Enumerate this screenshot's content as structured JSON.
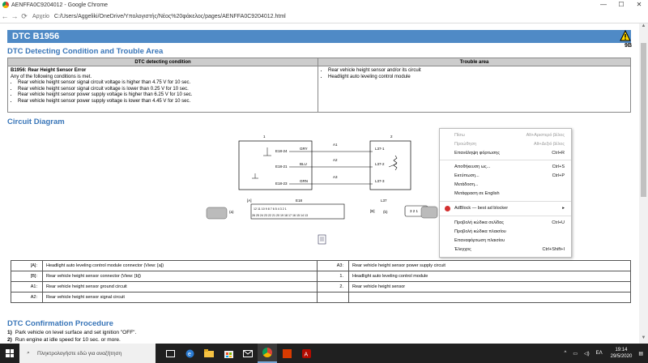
{
  "window": {
    "title": "AENFFA0C9204012 - Google Chrome",
    "min": "—",
    "max": "☐",
    "close": "✕"
  },
  "address": {
    "info": "Αρχείο",
    "url": "C:/Users/Aggeliki/OneDrive/Υπολογιστής/Νέος%20φάκελος/pages/AENFFA0C9204012.html",
    "back": "←",
    "forward": "→",
    "reload": "⟳"
  },
  "page": {
    "dtc_title": "DTC B1956",
    "ref": "9B",
    "section_condition": "DTC Detecting Condition and Trouble Area",
    "th_condition": "DTC detecting condition",
    "th_trouble": "Trouble area",
    "cond_title": "B1956: Rear Height Sensor Error",
    "cond_intro": "Any of the following conditions is met.",
    "cond_items": [
      "Rear vehicle height sensor signal circuit voltage is higher than 4.75 V for 10 sec.",
      "Rear vehicle height sensor signal circuit voltage is lower than 0.25 V for 10 sec.",
      "Rear vehicle height sensor power supply voltage is higher than 6.25 V for 10 sec.",
      "Rear vehicle height sensor power supply voltage is lower than 4.45 V for 10 sec."
    ],
    "trouble_items": [
      "Rear vehicle height sensor and/or its circuit",
      "Headlight auto leveling control module"
    ],
    "section_circuit": "Circuit Diagram",
    "diagram": {
      "box1": "1",
      "box2": "2",
      "e18_24": "E18-24",
      "e18_21": "E18-21",
      "e18_23": "E18-23",
      "gry": "GRY",
      "blu": "BLU",
      "grn": "GRN",
      "a1": "A1",
      "a2": "A2",
      "a3": "A3",
      "l37_1": "L37-1",
      "l37_2": "L37-2",
      "l37_3": "L37-3",
      "conn_a": "[A]",
      "conn_b": "[B]",
      "e18": "E18",
      "l37": "L37",
      "view_a": "(a)",
      "view_b": "(b)",
      "pins_top": "12 11 10 9 8 7 6 5 4 3 2 1",
      "pins_bot": "26 25 24 23 22 21 20 19 18 17 16 15 14 13",
      "pins_l37": "3 2 1"
    },
    "legend": [
      {
        "code": "[A]:",
        "desc": "Headlight auto leveling control module connector (View: [a])",
        "code2": "A3:",
        "desc2": "Rear vehicle height sensor power supply circuit"
      },
      {
        "code": "[B]:",
        "desc": "Rear vehicle height sensor connector (View: [b])",
        "code2": "1.",
        "desc2": "Headlight auto leveling control module"
      },
      {
        "code": "A1:",
        "desc": "Rear vehicle height sensor ground circuit",
        "code2": "2.",
        "desc2": "Rear vehicle height sensor"
      },
      {
        "code": "A2:",
        "desc": "Rear vehicle height sensor signal circuit",
        "code2": "",
        "desc2": ""
      }
    ],
    "section_confirm": "DTC Confirmation Procedure",
    "steps": [
      {
        "n": "1)",
        "t": "Park vehicle on level surface and set ignition \"OFF\"."
      },
      {
        "n": "2)",
        "t": "Run engine at idle speed for 10 sec. or more."
      }
    ]
  },
  "context_menu": {
    "items": [
      {
        "label": "Πίσω",
        "shortcut": "Alt+Αριστερό βέλος",
        "disabled": true
      },
      {
        "label": "Προώθηση",
        "shortcut": "Alt+Δεξιό βέλος",
        "disabled": true
      },
      {
        "label": "Επανάληψη φόρτωσης",
        "shortcut": "Ctrl+R",
        "disabled": false
      },
      {
        "label": "Αποθήκευση ως...",
        "shortcut": "Ctrl+S",
        "disabled": false
      },
      {
        "label": "Εκτύπωση...",
        "shortcut": "Ctrl+P",
        "disabled": false
      },
      {
        "label": "Μετάδοση...",
        "shortcut": "",
        "disabled": false
      },
      {
        "label": "Μετάφραση σε English",
        "shortcut": "",
        "disabled": false
      },
      {
        "label": "AdBlock — best ad blocker",
        "shortcut": "▸",
        "disabled": false
      },
      {
        "label": "Προβολή κώδικα σελίδας",
        "shortcut": "Ctrl+U",
        "disabled": false
      },
      {
        "label": "Προβολή κώδικα πλαισίου",
        "shortcut": "",
        "disabled": false
      },
      {
        "label": "Επαναφόρτωση πλαισίου",
        "shortcut": "",
        "disabled": false
      },
      {
        "label": "Έλεγχος",
        "shortcut": "Ctrl+Shift+I",
        "disabled": false
      }
    ]
  },
  "taskbar": {
    "search_placeholder": "Πληκτρολογήστε εδώ για αναζήτηση",
    "lang": "ΕΛ",
    "time": "19:14",
    "date": "29/5/2020"
  }
}
